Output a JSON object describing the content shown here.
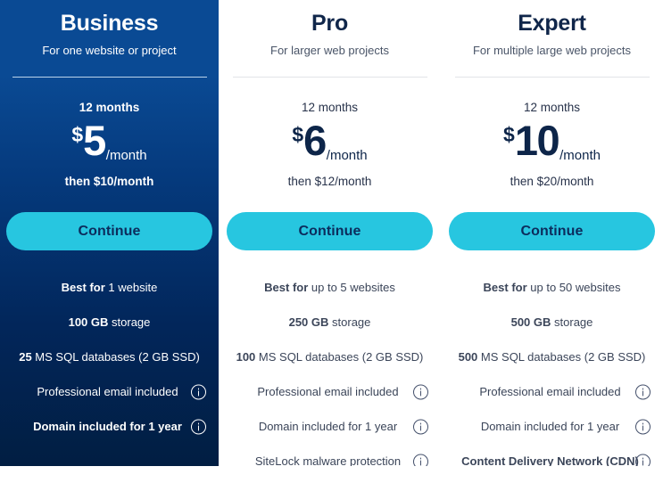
{
  "theme": {
    "business_bg_top": "#0a4a94",
    "business_bg_bottom": "#011e42",
    "cta_bg": "#27c6e0",
    "cta_text": "#0c2c5c",
    "heading_color": "#10264a",
    "body_text_color": "#3b4559"
  },
  "plans": [
    {
      "name": "Business",
      "subtitle": "For one website or project",
      "term": "12 months",
      "currency": "$",
      "amount": "5",
      "per": "/month",
      "then_price": "then $10/month",
      "cta_label": "Continue",
      "features": [
        {
          "bold": "Best for",
          "normal": " 1 website",
          "info": false
        },
        {
          "bold": "100 GB",
          "normal": " storage",
          "info": false
        },
        {
          "bold": "25",
          "normal": " MS SQL databases (2 GB SSD)",
          "info": false
        },
        {
          "bold": "",
          "normal": "Professional email included",
          "info": true
        },
        {
          "bold": "Domain included for 1 year",
          "normal": "",
          "info": true
        }
      ]
    },
    {
      "name": "Pro",
      "subtitle": "For larger web projects",
      "term": "12 months",
      "currency": "$",
      "amount": "6",
      "per": "/month",
      "then_price": "then $12/month",
      "cta_label": "Continue",
      "features": [
        {
          "bold": "Best for",
          "normal": " up to 5 websites",
          "info": false
        },
        {
          "bold": "250 GB",
          "normal": " storage",
          "info": false
        },
        {
          "bold": "100",
          "normal": " MS SQL databases (2 GB SSD)",
          "info": false
        },
        {
          "bold": "",
          "normal": "Professional email included",
          "info": true
        },
        {
          "bold": "",
          "normal": "Domain included for 1 year",
          "info": true
        },
        {
          "bold": "",
          "normal": "SiteLock malware protection",
          "info": true
        }
      ]
    },
    {
      "name": "Expert",
      "subtitle": "For multiple large web projects",
      "term": "12 months",
      "currency": "$",
      "amount": "10",
      "per": "/month",
      "then_price": "then $20/month",
      "cta_label": "Continue",
      "features": [
        {
          "bold": "Best for",
          "normal": " up to 50 websites",
          "info": false
        },
        {
          "bold": "500 GB",
          "normal": " storage",
          "info": false
        },
        {
          "bold": "500",
          "normal": " MS SQL databases (2 GB SSD)",
          "info": false
        },
        {
          "bold": "",
          "normal": "Professional email included",
          "info": true
        },
        {
          "bold": "",
          "normal": "Domain included for 1 year",
          "info": true
        },
        {
          "bold": "Content Delivery Network (CDN)",
          "normal": "",
          "info": true
        }
      ]
    }
  ]
}
